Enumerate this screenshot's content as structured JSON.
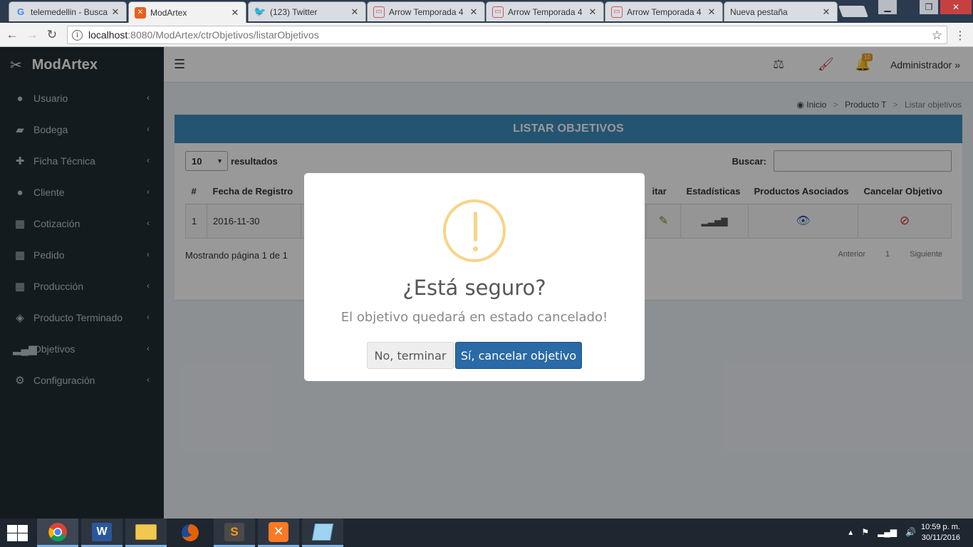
{
  "browser": {
    "tabs": [
      {
        "label": "telemedellin - Busca",
        "icon": "google-icon"
      },
      {
        "label": "ModArtex",
        "icon": "xampp-icon",
        "active": true
      },
      {
        "label": "(123) Twitter",
        "icon": "twitter-icon"
      },
      {
        "label": "Arrow Temporada 4",
        "icon": "tv-icon"
      },
      {
        "label": "Arrow Temporada 4",
        "icon": "tv-icon"
      },
      {
        "label": "Arrow Temporada 4",
        "icon": "tv-icon"
      },
      {
        "label": "Nueva pestaña",
        "icon": ""
      }
    ],
    "url_host": "localhost",
    "url_path": ":8080/ModArtex/ctrObjetivos/listarObjetivos"
  },
  "app": {
    "name": "ModArtex",
    "user": "Administrador",
    "notification_count": "10"
  },
  "sidebar": {
    "items": [
      {
        "label": "Usuario",
        "icon": "user-icon"
      },
      {
        "label": "Bodega",
        "icon": "truck-icon"
      },
      {
        "label": "Ficha Técnica",
        "icon": "puzzle-icon"
      },
      {
        "label": "Cliente",
        "icon": "users-icon"
      },
      {
        "label": "Cotización",
        "icon": "calculator-icon"
      },
      {
        "label": "Pedido",
        "icon": "calendar-icon"
      },
      {
        "label": "Producción",
        "icon": "calendar-icon"
      },
      {
        "label": "Producto Terminado",
        "icon": "dropbox-icon"
      },
      {
        "label": "Objetivos",
        "icon": "signal-icon"
      },
      {
        "label": "Configuración",
        "icon": "cogs-icon"
      }
    ]
  },
  "breadcrumb": {
    "home": "Inicio",
    "section": "Producto T",
    "current": "Listar objetivos"
  },
  "panel": {
    "title": "LISTAR OBJETIVOS",
    "length_value": "10",
    "length_label": "resultados",
    "search_label": "Buscar:",
    "search_value": "",
    "columns": {
      "num": "#",
      "date": "Fecha de Registro",
      "edit": "itar",
      "stats": "Estadísticas",
      "products": "Productos Asociados",
      "cancel": "Cancelar Objetivo"
    },
    "rows": [
      {
        "num": "1",
        "date": "2016-11-30"
      }
    ],
    "info": "Mostrando página 1 de 1",
    "pager": {
      "prev": "Anterior",
      "page": "1",
      "next": "Siguiente"
    }
  },
  "dialog": {
    "title": "¿Está seguro?",
    "text": "El objetivo quedará en estado cancelado!",
    "cancel_label": "No, terminar",
    "confirm_label": "Sí, cancelar objetivo"
  },
  "taskbar": {
    "apps": [
      "chrome-icon",
      "word-icon",
      "file-explorer-icon",
      "firefox-icon",
      "sublime-icon",
      "xampp-icon",
      "notepad-icon"
    ],
    "time": "10:59 p. m.",
    "date": "30/11/2016"
  },
  "colors": {
    "sidebar_bg": "#222d32",
    "header_accent": "#3c8dbc",
    "confirm_button": "#2a6aa6",
    "warning": "#f8d486"
  }
}
